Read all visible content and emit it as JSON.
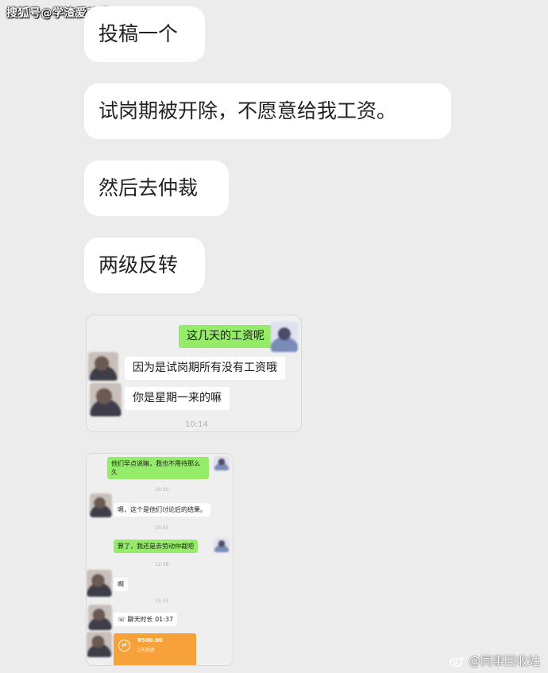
{
  "watermark_top": "搜狐号@学渣爱吐槽",
  "watermark_bottom": "@同事回收站",
  "messages": [
    {
      "text": "投稿一个"
    },
    {
      "text": "试岗期被开除，不愿意给我工资。"
    },
    {
      "text": "然后去仲裁"
    },
    {
      "text": "两级反转"
    }
  ],
  "screenshot1": {
    "messages": [
      {
        "text": "这几天的工资呢",
        "side": "right"
      },
      {
        "text": "因为是试岗期所有没有工资哦",
        "side": "left"
      },
      {
        "text": "你是星期一来的嘛",
        "side": "left"
      }
    ],
    "timestamp": "10:14"
  },
  "screenshot2": {
    "items": [
      {
        "text": "他们早点说嘛，我也不用待那么久",
        "side": "right"
      },
      {
        "text": "10:20",
        "type": "time"
      },
      {
        "text": "嗯，这个是他们讨论后的结果。",
        "side": "left"
      },
      {
        "text": "10:55",
        "type": "time"
      },
      {
        "text": "算了，我还是去劳动仲裁吧",
        "side": "right"
      },
      {
        "text": "12:38",
        "type": "time"
      },
      {
        "text": "啊",
        "side": "left"
      },
      {
        "text": "15:33",
        "type": "time"
      },
      {
        "text": "聊天时长 01:37",
        "side": "left"
      }
    ],
    "transfer": {
      "amount": "¥500.00",
      "note": "1天后收"
    }
  },
  "colors": {
    "background": "#ececec",
    "bubble": "#ffffff",
    "wechat_green": "#95ec69",
    "transfer_orange": "#f7a13a"
  }
}
